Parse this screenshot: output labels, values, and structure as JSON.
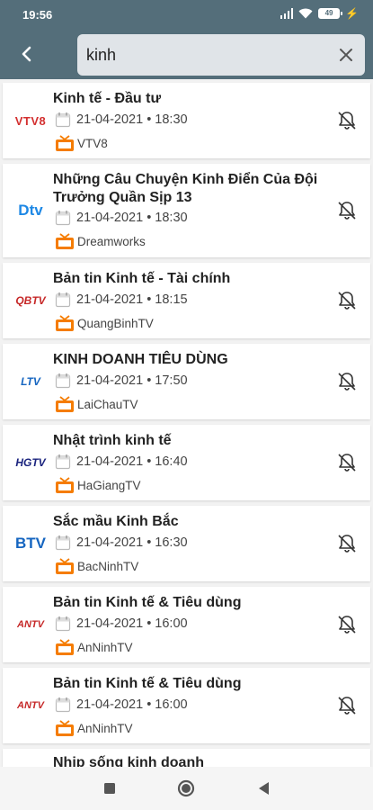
{
  "status": {
    "time": "19:56",
    "battery": "49"
  },
  "search": {
    "query": "kinh"
  },
  "programs": [
    {
      "title": "Kinh tế - Đầu tư",
      "datetime": "21-04-2021 • 18:30",
      "channel": "VTV8",
      "logo": "VTV8"
    },
    {
      "title": "Những Câu Chuyện Kinh Điển Của Đội Trưởng Quần Sịp 13",
      "datetime": "21-04-2021 • 18:30",
      "channel": "Dreamworks",
      "logo": "Dtv"
    },
    {
      "title": "Bản tin Kinh tế - Tài chính",
      "datetime": "21-04-2021 • 18:15",
      "channel": "QuangBinhTV",
      "logo": "QBTV"
    },
    {
      "title": "KINH DOANH TIÊU DÙNG",
      "datetime": "21-04-2021 • 17:50",
      "channel": "LaiChauTV",
      "logo": "LTV"
    },
    {
      "title": "Nhật trình kinh tế",
      "datetime": "21-04-2021 • 16:40",
      "channel": "HaGiangTV",
      "logo": "HGTV"
    },
    {
      "title": "Sắc mầu Kinh Bắc",
      "datetime": "21-04-2021 • 16:30",
      "channel": "BacNinhTV",
      "logo": "BTV"
    },
    {
      "title": "Bản tin Kinh tế & Tiêu dùng",
      "datetime": "21-04-2021 • 16:00",
      "channel": "AnNinhTV",
      "logo": "ANTV"
    },
    {
      "title": "Bản tin Kinh tế & Tiêu dùng",
      "datetime": "21-04-2021 • 16:00",
      "channel": "AnNinhTV",
      "logo": "ANTV"
    },
    {
      "title": "Nhịp sống kinh doanh"
    }
  ],
  "colors": {
    "appbar": "#546e7a",
    "tv_icon": "#f57c00",
    "search_bg": "#e0e4e8"
  }
}
